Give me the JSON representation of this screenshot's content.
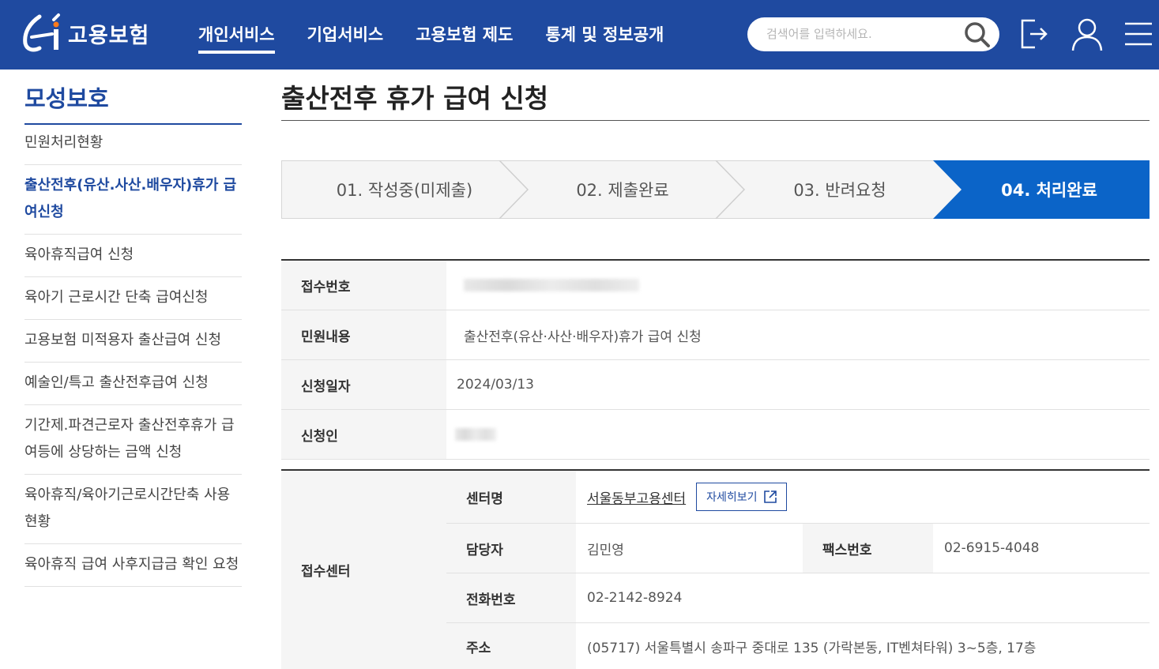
{
  "header": {
    "logo_text": "고용보험",
    "nav": [
      "개인서비스",
      "기업서비스",
      "고용보험 제도",
      "통계 및 정보공개"
    ],
    "search_placeholder": "검색어를 입력하세요.",
    "icons": [
      "search-icon",
      "logout-icon",
      "user-icon",
      "menu-icon"
    ]
  },
  "sidebar": {
    "title": "모성보호",
    "items": [
      "민원처리현황",
      "출산전후(유산.사산.배우자)휴가 급여신청",
      "육아휴직급여 신청",
      "육아기 근로시간 단축 급여신청",
      "고용보험 미적용자 출산급여 신청",
      "예술인/특고 출산전후급여 신청",
      "기간제.파견근로자 출산전후휴가 급여등에 상당하는 금액 신청",
      "육아휴직/육아기근로시간단축 사용 현황",
      "육아휴직 급여 사후지급금 확인 요청"
    ],
    "active_index": 1
  },
  "page_title": "출산전후 휴가 급여 신청",
  "steps": [
    "01. 작성중(미제출)",
    "02. 제출완료",
    "03. 반려요청",
    "04. 처리완료"
  ],
  "current_step": 4,
  "info": {
    "receipt_no_label": "접수번호",
    "receipt_no_value": "",
    "content_label": "민원내용",
    "content_value": "출산전후(유산·사산·배우자)휴가 급여 신청",
    "date_label": "신청일자",
    "date_value": "2024/03/13",
    "applicant_label": "신청인",
    "applicant_value": ""
  },
  "center": {
    "label": "접수센터",
    "name_label": "센터명",
    "name_value": "서울동부고용센터",
    "detail_button": "자세히보기",
    "manager_label": "담당자",
    "manager_value": "김민영",
    "fax_label": "팩스번호",
    "fax_value": "02-6915-4048",
    "phone_label": "전화번호",
    "phone_value": "02-2142-8924",
    "address_label": "주소",
    "address_value": "(05717) 서울특별시 송파구 중대로 135 (가락본동, IT벤쳐타워) 3~5층, 17층"
  },
  "colors": {
    "header": "#1f4aa0",
    "step_active": "#0b64c8",
    "table_head": "#f5f5f5"
  }
}
